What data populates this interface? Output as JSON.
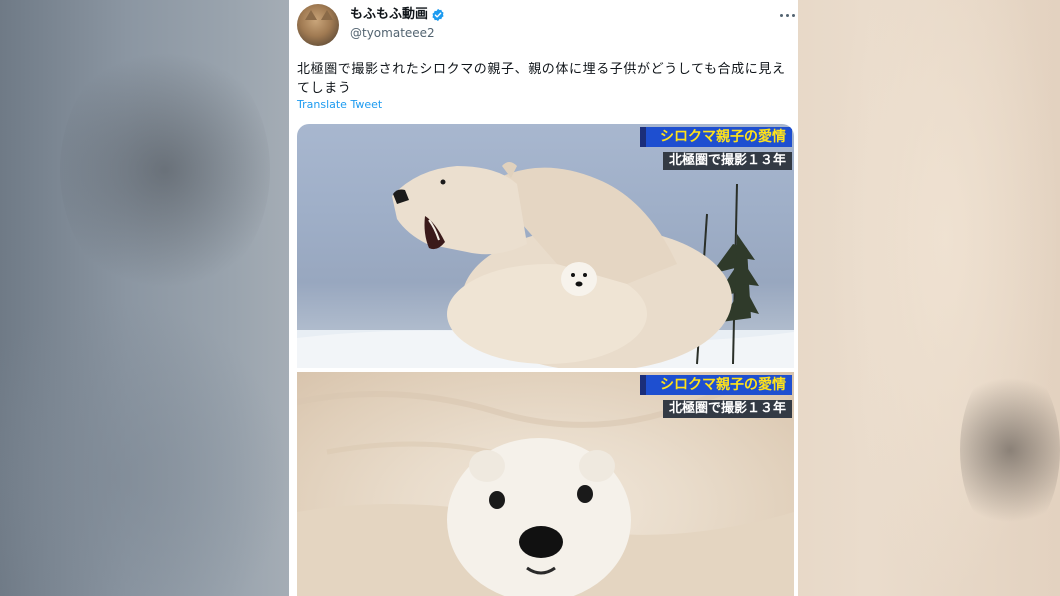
{
  "tweet": {
    "display_name": "もふもふ動画",
    "handle": "@tyomateee2",
    "text": "北極圏で撮影されたシロクマの親子、親の体に埋る子供がどうしても合成に見えてしまう",
    "translate_label": "Translate Tweet"
  },
  "media": {
    "photo1": {
      "caption_title": "シロクマ親子の愛情",
      "caption_sub": "北極圏で撮影１３年"
    },
    "photo2": {
      "caption_title": "シロクマ親子の愛情",
      "caption_sub": "北極圏で撮影１３年"
    }
  },
  "colors": {
    "verified": "#1d9bf0",
    "link": "#1d9bf0",
    "caption_bg": "#1e4fd0",
    "caption_text": "#ffe21a"
  },
  "icons": [
    "verified-icon",
    "more-icon"
  ]
}
